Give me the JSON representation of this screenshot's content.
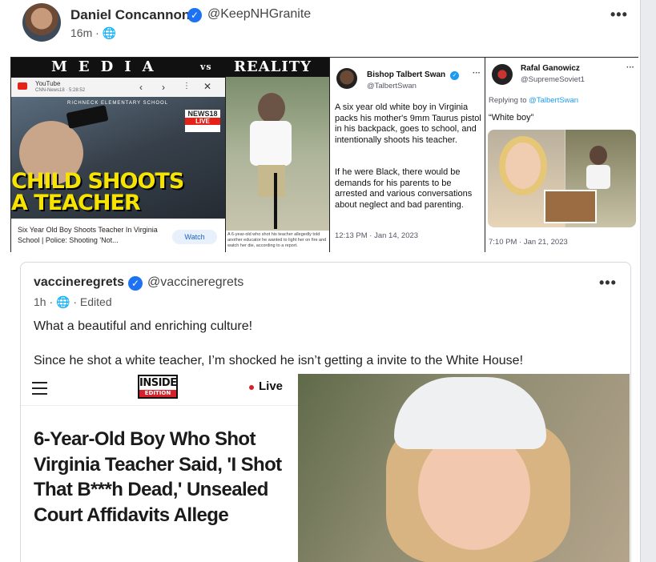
{
  "outer_post": {
    "author_name": "Daniel Concannon",
    "handle": "@KeepNHGranite",
    "time": "16m",
    "more_label": "•••"
  },
  "composite": {
    "banner": {
      "left": "MEDIA",
      "vs": "vs",
      "right": "REALITY"
    },
    "youtube": {
      "app_name": "YouTube",
      "channel_line": "CNN-News18 · 5:28:52",
      "school_sign": "RICHNECK ELEMENTARY SCHOOL",
      "news_logo": "NEWS18",
      "live_badge": "LIVE",
      "thumbnail_title_1": "CHILD SHOOTS",
      "thumbnail_title_2": "A TEACHER",
      "caption": "Six Year Old Boy Shoots Teacher In Virginia School | Police: Shooting 'Not...",
      "watch_label": "Watch"
    },
    "reality_caption": "A 6-year-old who shot his teacher allegedly told another educator he wanted to light her on fire and watch her die, according to a report.",
    "tweet_swan": {
      "name": "Bishop Talbert Swan",
      "handle": "@TalbertSwan",
      "text_1": "A six year old white boy in Virginia packs his mother's 9mm Taurus pistol in his backpack, goes to school, and intentionally shoots his teacher.",
      "text_2": "If he were Black, there would be demands for his parents to be arrested and various conversations about neglect and bad parenting.",
      "time": "12:13 PM · Jan 14, 2023"
    },
    "tweet_rafal": {
      "name": "Rafal Ganowicz",
      "handle": "@SupremeSoviet1",
      "replying_prefix": "Replying to ",
      "replying_to": "@TalbertSwan",
      "text": "“White boy”",
      "time": "7:10 PM · Jan 21, 2023"
    }
  },
  "quoted_post": {
    "author_name": "vaccineregrets",
    "handle": "@vaccineregrets",
    "time": "1h",
    "edited_label": "Edited",
    "more_label": "•••",
    "text_1": "What a beautiful and enriching culture!",
    "text_2": "Since he shot a white teacher, I’m shocked he isn’t getting a invite to the White House!",
    "inside_edition": {
      "logo_top": "INSIDE",
      "logo_bottom": "EDITION",
      "live_label": "Live",
      "headline": "6-Year-Old Boy Who Shot Virginia Teacher Said, 'I Shot That B***h Dead,' Unsealed Court Affidavits Allege"
    }
  },
  "icons": {
    "globe": "globe-icon",
    "verified": "verified-badge-icon"
  },
  "colors": {
    "verified_blue": "#1d72f3",
    "link_blue": "#1d9bf0",
    "ie_red": "#d6202a",
    "thumb_yellow": "#f6e400"
  }
}
